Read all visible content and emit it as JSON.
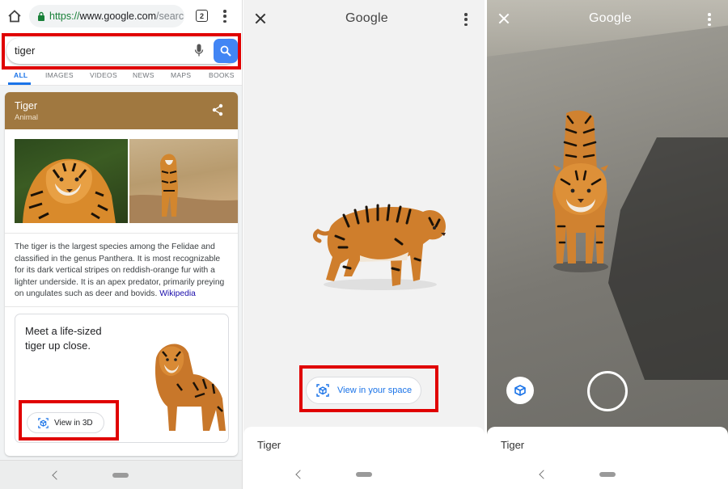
{
  "panel1": {
    "url": {
      "scheme": "https://",
      "host": "www.google.com",
      "path": "/searc"
    },
    "tab_count": "2",
    "search": {
      "query": "tiger"
    },
    "tabs": [
      "ALL",
      "IMAGES",
      "VIDEOS",
      "NEWS",
      "MAPS",
      "BOOKS"
    ],
    "knowledge_panel": {
      "title": "Tiger",
      "subtitle": "Animal",
      "description": "The tiger is the largest species among the Felidae and classified in the genus Panthera. It is most recognizable for its dark vertical stripes on reddish-orange fur with a lighter underside. It is an apex predator, primarily preying on ungulates such as deer and bovids.",
      "link": "Wikipedia"
    },
    "ar_card": {
      "text": "Meet a life-sized tiger up close.",
      "button": "View in 3D"
    }
  },
  "panel2": {
    "title": "Google",
    "button": "View in your space",
    "sheet_title": "Tiger"
  },
  "panel3": {
    "title": "Google",
    "sheet_title": "Tiger"
  },
  "colors": {
    "highlight": "#e00000",
    "accent": "#1a73e8",
    "panel_header": "#a07840"
  }
}
